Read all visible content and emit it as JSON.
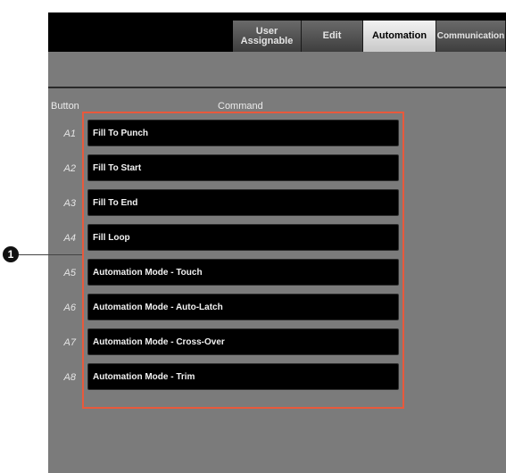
{
  "tabs": {
    "user_assignable": "User\nAssignable",
    "edit": "Edit",
    "automation": "Automation",
    "communication": "Communication"
  },
  "table": {
    "header_button": "Button",
    "header_command": "Command"
  },
  "rows": [
    {
      "button": "A1",
      "command": "Fill To Punch"
    },
    {
      "button": "A2",
      "command": "Fill To Start"
    },
    {
      "button": "A3",
      "command": "Fill To End"
    },
    {
      "button": "A4",
      "command": "Fill Loop"
    },
    {
      "button": "A5",
      "command": "Automation Mode - Touch"
    },
    {
      "button": "A6",
      "command": "Automation Mode - Auto-Latch"
    },
    {
      "button": "A7",
      "command": "Automation Mode - Cross-Over"
    },
    {
      "button": "A8",
      "command": "Automation Mode - Trim"
    }
  ],
  "callout": {
    "number": "1"
  },
  "colors": {
    "highlight": "#e8593c",
    "active_tab": "#e0e0e0"
  }
}
